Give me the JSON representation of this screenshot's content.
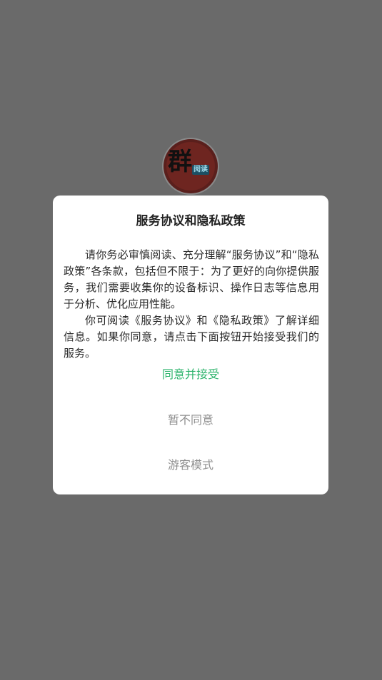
{
  "logo": {
    "main_char": "群",
    "sub_text": "阅读"
  },
  "dialog": {
    "title": "服务协议和隐私政策",
    "paragraph1": "请你务必审慎阅读、充分理解“服务协议”和“隐私政策”各条款，包括但不限于：为了更好的向你提供服务，我们需要收集你的设备标识、操作日志等信息用于分析、优化应用性能。",
    "paragraph2": "你可阅读《服务协议》和《隐私政策》了解详细信息。如果你同意，请点击下面按钮开始接受我们的服务。",
    "agree_label": "同意并接受",
    "disagree_label": "暂不同意",
    "guest_label": "游客模式"
  },
  "colors": {
    "accent": "#2bb36b",
    "overlay": "#6a6a6a",
    "secondary_text": "#8f8f8f"
  }
}
